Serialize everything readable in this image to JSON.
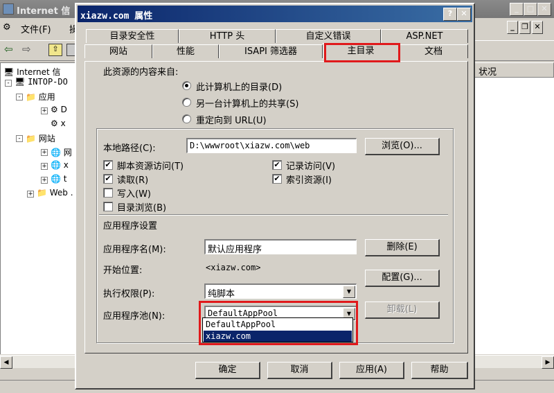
{
  "background_window": {
    "title": "Internet 信",
    "menu": [
      "文件(F)",
      "操"
    ],
    "tree": {
      "root": "Internet 信",
      "server": "INTOP-DO",
      "app_pools": "应用",
      "app_items": [
        "D",
        "x"
      ],
      "websites": "网站",
      "site_items": [
        "网",
        "x",
        "t"
      ],
      "web_ext": "Web ."
    },
    "column_header": "状况"
  },
  "dialog": {
    "title": "xiazw.com 属性",
    "help_btn": "?",
    "close_btn": "✕",
    "tabs_top": [
      "目录安全性",
      "HTTP 头",
      "自定义错误",
      "ASP.NET"
    ],
    "tabs_bottom": [
      "网站",
      "性能",
      "ISAPI 筛选器",
      "主目录",
      "文档"
    ],
    "active_tab": "主目录",
    "content_source": {
      "label": "此资源的内容来自:",
      "options": [
        "此计算机上的目录(D)",
        "另一台计算机上的共享(S)",
        "重定向到 URL(U)"
      ],
      "selected_index": 0
    },
    "local_path": {
      "label": "本地路径(C):",
      "value": "D:\\wwwroot\\xiazw.com\\web",
      "browse_btn": "浏览(O)..."
    },
    "permissions_left": [
      {
        "label": "脚本资源访问(T)",
        "checked": true
      },
      {
        "label": "读取(R)",
        "checked": true
      },
      {
        "label": "写入(W)",
        "checked": false
      },
      {
        "label": "目录浏览(B)",
        "checked": false
      }
    ],
    "permissions_right": [
      {
        "label": "记录访问(V)",
        "checked": true
      },
      {
        "label": "索引资源(I)",
        "checked": true
      }
    ],
    "app_settings": {
      "section_label": "应用程序设置",
      "app_name_label": "应用程序名(M):",
      "app_name_value": "默认应用程序",
      "remove_btn": "删除(E)",
      "start_point_label": "开始位置:",
      "start_point_value": "<xiazw.com>",
      "config_btn": "配置(G)...",
      "exec_perm_label": "执行权限(P):",
      "exec_perm_value": "纯脚本",
      "app_pool_label": "应用程序池(N):",
      "app_pool_value": "DefaultAppPool",
      "unload_btn": "卸载(L)",
      "app_pool_options": [
        "DefaultAppPool",
        "xiazw.com"
      ],
      "app_pool_highlighted_index": 1
    },
    "footer": {
      "ok": "确定",
      "cancel": "取消",
      "apply": "应用(A)",
      "help": "帮助"
    }
  },
  "colors": {
    "title_bar": "#0a246a",
    "annotation_red": "#e0191b",
    "face": "#d4d0c8"
  }
}
